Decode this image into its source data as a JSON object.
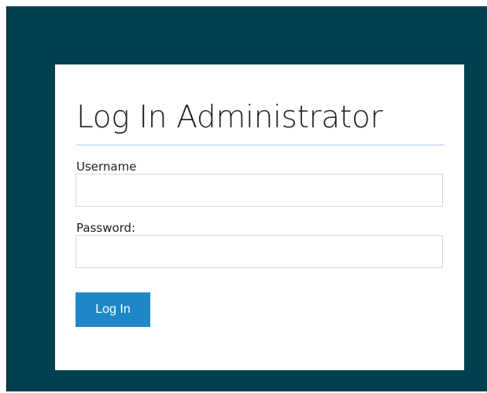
{
  "colors": {
    "frame_background": "#02404f",
    "panel_background": "#ffffff",
    "accent_button": "#1e88c7",
    "divider": "#a9c6e3"
  },
  "login": {
    "title": "Log In Administrator",
    "username_label": "Username",
    "username_value": "",
    "password_label": "Password:",
    "password_value": "",
    "submit_label": "Log In"
  }
}
